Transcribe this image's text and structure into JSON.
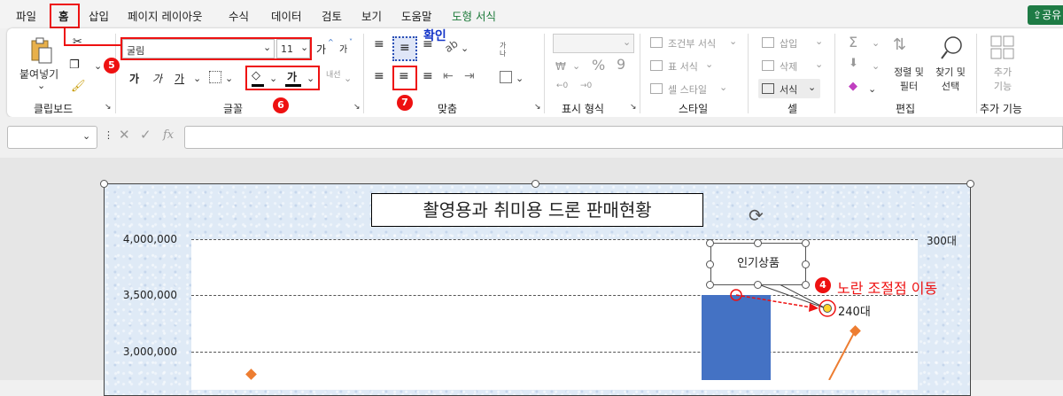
{
  "menu": {
    "items": [
      "파일",
      "홈",
      "삽입",
      "페이지 레이아웃",
      "수식",
      "데이터",
      "검토",
      "보기",
      "도움말",
      "도형 서식"
    ],
    "share": "공유"
  },
  "clipboard": {
    "paste": "붙여넣기",
    "group": "클립보드"
  },
  "font": {
    "name": "굴림",
    "size": "11",
    "grow": "가",
    "bold": "가",
    "italic": "가",
    "underline": "가",
    "font_color_glyph": "가",
    "wrap_glyph": "내선",
    "group": "글꼴"
  },
  "alignment": {
    "group": "맞춤",
    "vertical_label": "가나",
    "check_note": "확인"
  },
  "number": {
    "group": "표시 형식",
    "percent": "%",
    "comma": "9"
  },
  "styles": {
    "conditional": "조건부 서식",
    "table": "표 서식",
    "cell_style": "셀 스타일",
    "group": "스타일"
  },
  "cells": {
    "insert": "삽입",
    "delete": "삭제",
    "format": "서식",
    "group": "셀"
  },
  "editing": {
    "sum_glyph": "Σ",
    "sort_filter": "정렬 및 필터",
    "find_select": "찾기 및 선택",
    "group": "편집"
  },
  "addins": {
    "label": "추가 기능",
    "group": "추가 기능"
  },
  "formula_bar": {
    "fx": "fx"
  },
  "annotations": {
    "badge4": "4",
    "badge5": "5",
    "badge6": "6",
    "badge7": "7",
    "move_handle": "노란 조절점 이동"
  },
  "colors": {
    "accent_red": "#e11111",
    "bar_blue": "#4472c4",
    "line_orange": "#ed7d31"
  },
  "shape": {
    "callout_text": "인기상품"
  },
  "chart_data": {
    "type": "bar",
    "title": "촬영용과 취미용 드론 판매현황",
    "yticks": [
      "4,000,000",
      "3,500,000",
      "3,000,000"
    ],
    "secondary_ytick": "300대",
    "ylim": [
      2750000,
      4000000
    ],
    "bar_value": 3500000,
    "point_label": "240대"
  }
}
